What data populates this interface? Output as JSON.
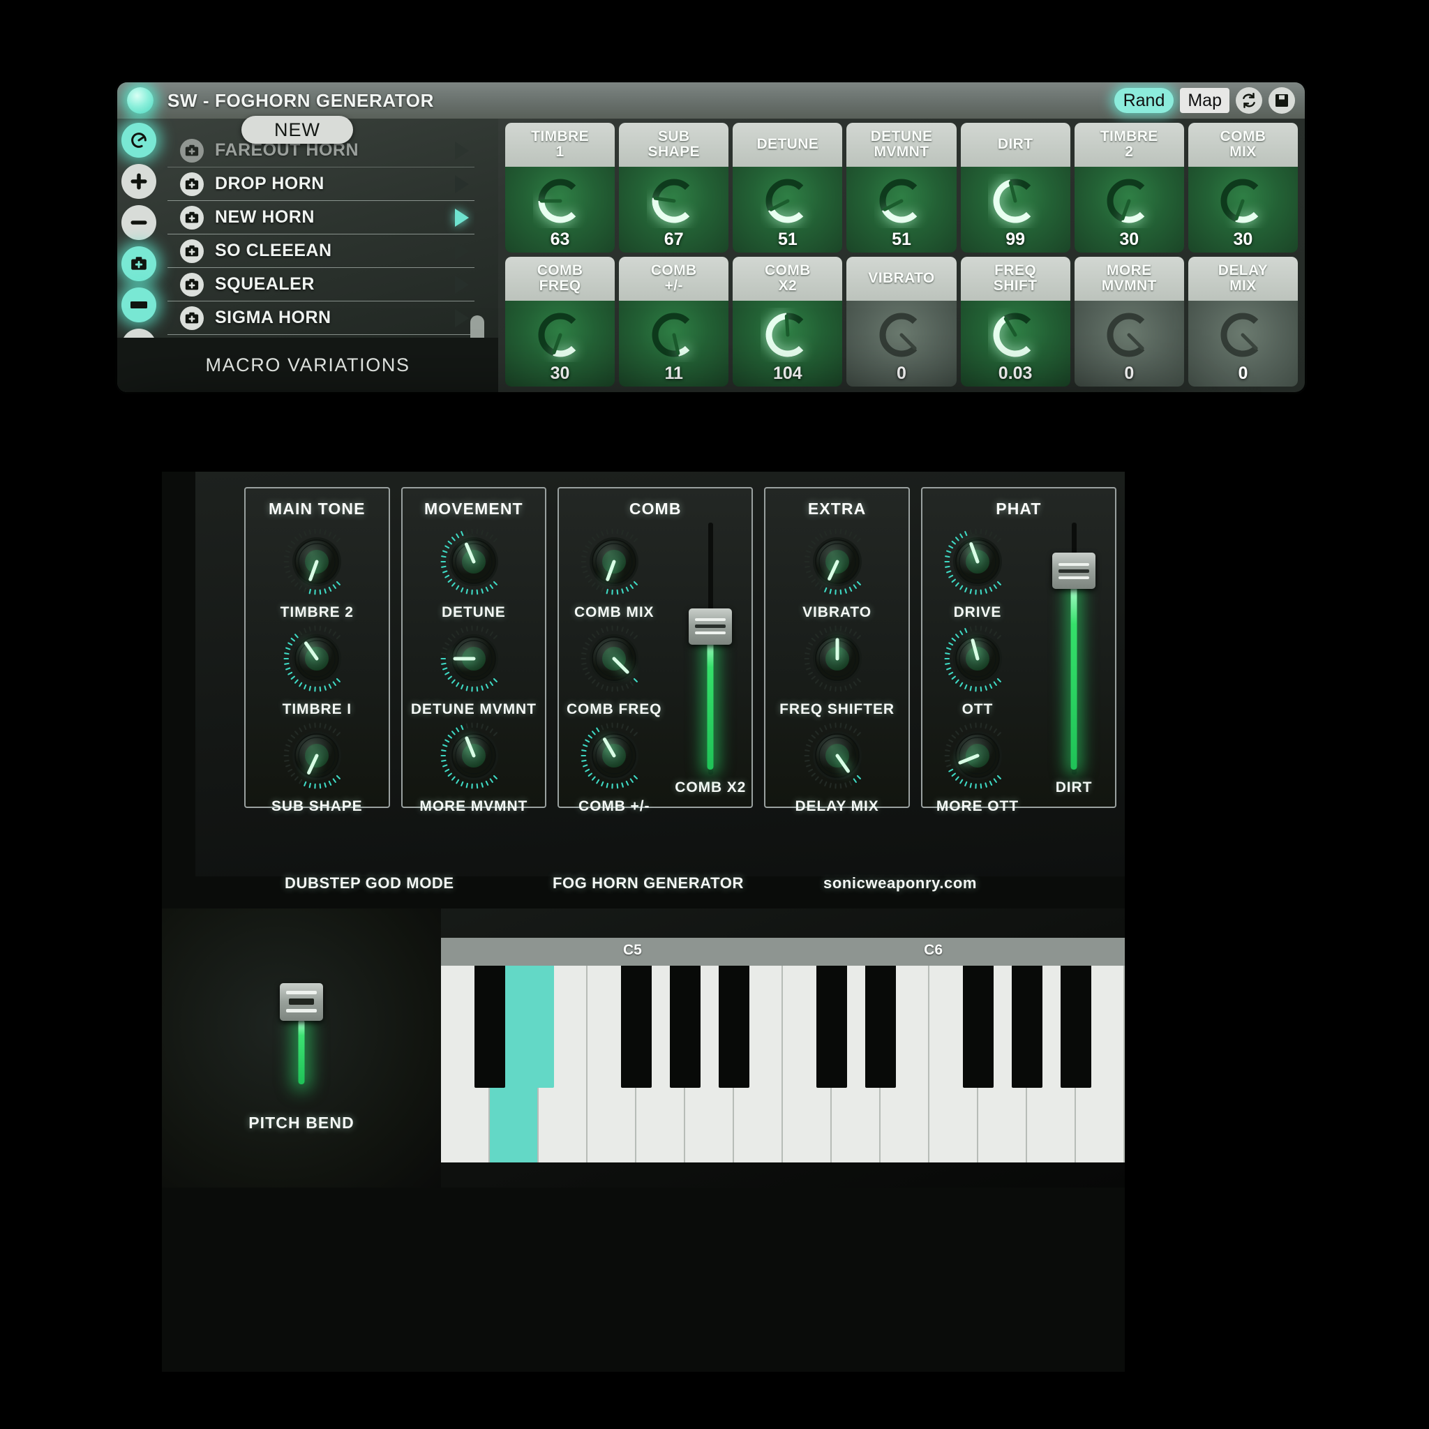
{
  "macro_window": {
    "title": "SW - FOGHORN GENERATOR",
    "led_icon": "power-led-icon",
    "toolbar": {
      "rand_label": "Rand",
      "map_label": "Map",
      "refresh_icon": "refresh-icon",
      "save_icon": "save-disk-icon"
    },
    "browser": {
      "new_button_label": "NEW",
      "macro_variations_label": "MACRO VARIATIONS",
      "rail_items": [
        {
          "icon": "knob-dial-icon",
          "lit": true
        },
        {
          "icon": "plus-icon",
          "lit": false
        },
        {
          "icon": "minus-icon",
          "lit": false
        },
        {
          "icon": "add-preset-icon",
          "lit": true
        },
        {
          "icon": "rename-bar-icon",
          "lit": true
        },
        {
          "icon": "list-icon",
          "lit": false
        }
      ],
      "presets": [
        {
          "name": "FAREOUT HORN",
          "icon": "preset-icon",
          "selected": false
        },
        {
          "name": "DROP HORN",
          "icon": "preset-icon",
          "selected": false
        },
        {
          "name": "NEW HORN",
          "icon": "preset-icon",
          "selected": true
        },
        {
          "name": "SO CLEEEAN",
          "icon": "preset-icon",
          "selected": false
        },
        {
          "name": "SQUEALER",
          "icon": "preset-icon",
          "selected": false
        },
        {
          "name": "SIGMA HORN",
          "icon": "preset-icon",
          "selected": false
        }
      ]
    },
    "macro_knobs": [
      {
        "label_line1": "TIMBRE",
        "label_line2": "1",
        "value": "63",
        "pct": 0.5,
        "on": true
      },
      {
        "label_line1": "SUB",
        "label_line2": "SHAPE",
        "value": "67",
        "pct": 0.53,
        "on": true
      },
      {
        "label_line1": "DETUNE",
        "label_line2": "",
        "value": "51",
        "pct": 0.4,
        "on": true
      },
      {
        "label_line1": "DETUNE",
        "label_line2": "MVMNT",
        "value": "51",
        "pct": 0.4,
        "on": true
      },
      {
        "label_line1": "DIRT",
        "label_line2": "",
        "value": "99",
        "pct": 0.78,
        "on": true
      },
      {
        "label_line1": "TIMBRE",
        "label_line2": "2",
        "value": "30",
        "pct": 0.24,
        "on": true
      },
      {
        "label_line1": "COMB",
        "label_line2": "MIX",
        "value": "30",
        "pct": 0.24,
        "on": true
      },
      {
        "label_line1": "COMB",
        "label_line2": "FREQ",
        "value": "30",
        "pct": 0.24,
        "on": true
      },
      {
        "label_line1": "COMB",
        "label_line2": "+/-",
        "value": "11",
        "pct": 0.12,
        "on": true
      },
      {
        "label_line1": "COMB",
        "label_line2": "X2",
        "value": "104",
        "pct": 0.82,
        "on": true
      },
      {
        "label_line1": "VIBRATO",
        "label_line2": "",
        "value": "0",
        "pct": 0.0,
        "on": false
      },
      {
        "label_line1": "FREQ",
        "label_line2": "SHIFT",
        "value": "0.03",
        "pct": 0.72,
        "on": true
      },
      {
        "label_line1": "MORE",
        "label_line2": "MVMNT",
        "value": "0",
        "pct": 0.0,
        "on": false
      },
      {
        "label_line1": "DELAY",
        "label_line2": "MIX",
        "value": "0",
        "pct": 0.0,
        "on": false
      }
    ]
  },
  "plugin_window": {
    "modules": [
      {
        "title": "MAIN TONE",
        "knobs": [
          {
            "label": "TIMBRE 2",
            "angle": 200
          },
          {
            "label": "TIMBRE I",
            "angle": 325
          },
          {
            "label": "SUB SHAPE",
            "angle": 205
          }
        ],
        "fader": null
      },
      {
        "title": "MOVEMENT",
        "knobs": [
          {
            "label": "DETUNE",
            "angle": 337
          },
          {
            "label": "DETUNE MVMNT",
            "angle": 270
          },
          {
            "label": "MORE MVMNT",
            "angle": 338
          }
        ],
        "fader": null
      },
      {
        "title": "COMB",
        "knobs": [
          {
            "label": "COMB MIX",
            "angle": 200
          },
          {
            "label": "COMB FREQ",
            "angle": 135
          },
          {
            "label": "COMB +/-",
            "angle": 330
          }
        ],
        "fader": {
          "label": "COMB X2",
          "position": 0.56
        }
      },
      {
        "title": "EXTRA",
        "knobs": [
          {
            "label": "VIBRATO",
            "angle": 205
          },
          {
            "label": "FREQ SHIFTER",
            "angle": 0
          },
          {
            "label": "DELAY MIX",
            "angle": 145
          }
        ],
        "fader": null
      },
      {
        "title": "PHAT",
        "knobs": [
          {
            "label": "DRIVE",
            "angle": 340
          },
          {
            "label": "OTT",
            "angle": 345
          },
          {
            "label": "MORE OTT",
            "angle": 248
          }
        ],
        "fader": {
          "label": "DIRT",
          "position": 0.78
        }
      }
    ],
    "footer": {
      "left": "DUBSTEP GOD MODE",
      "center": "FOG HORN GENERATOR",
      "right": "sonicweaponry.com"
    },
    "pitch_bend": {
      "label": "PITCH BEND",
      "position": 0.72
    },
    "keyboard": {
      "octave_labels": [
        "C5",
        "C6"
      ],
      "white_key_count": 14,
      "active_white_key_index": 1,
      "active_black_key_index": 1,
      "black_key_slots": [
        0,
        1,
        3,
        4,
        5,
        7,
        8,
        10,
        11,
        12
      ]
    }
  },
  "colors": {
    "accent_teal": "#63d8c6",
    "accent_green": "#2fe06a",
    "panel_dark": "#141715",
    "cap_grey": "#c6ccc6"
  }
}
